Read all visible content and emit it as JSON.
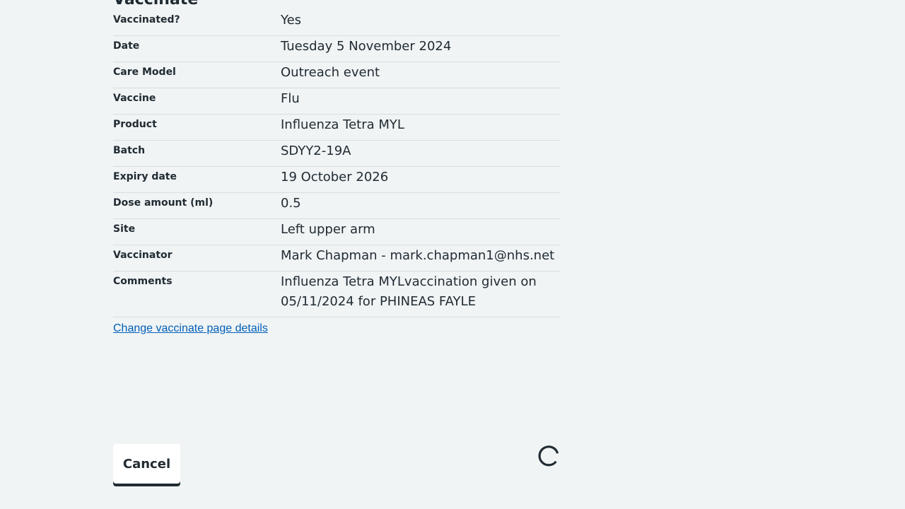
{
  "section": {
    "heading": "Vaccinate"
  },
  "rows": [
    {
      "key": "Vaccinated?",
      "value": "Yes"
    },
    {
      "key": "Date",
      "value": "Tuesday 5 November 2024"
    },
    {
      "key": "Care Model",
      "value": "Outreach event"
    },
    {
      "key": "Vaccine",
      "value": "Flu"
    },
    {
      "key": "Product",
      "value": "Influenza Tetra MYL"
    },
    {
      "key": "Batch",
      "value": "SDYY2-19A"
    },
    {
      "key": "Expiry date",
      "value": "19 October 2026"
    },
    {
      "key": "Dose amount (ml)",
      "value": "0.5"
    },
    {
      "key": "Site",
      "value": "Left upper arm"
    },
    {
      "key": "Vaccinator",
      "value": "Mark Chapman - mark.chapman1@nhs.net"
    },
    {
      "key": "Comments",
      "value": "Influenza Tetra MYLvaccination given on 05/11/2024 for PHINEAS FAYLE"
    }
  ],
  "change_link": "Change vaccinate page details",
  "actions": {
    "cancel_label": "Cancel"
  },
  "colors": {
    "background": "#f0f4f5",
    "text": "#212b32",
    "link": "#005eb8",
    "divider": "#d8dde0"
  },
  "icons": {
    "loading": "loading-spinner-icon"
  }
}
